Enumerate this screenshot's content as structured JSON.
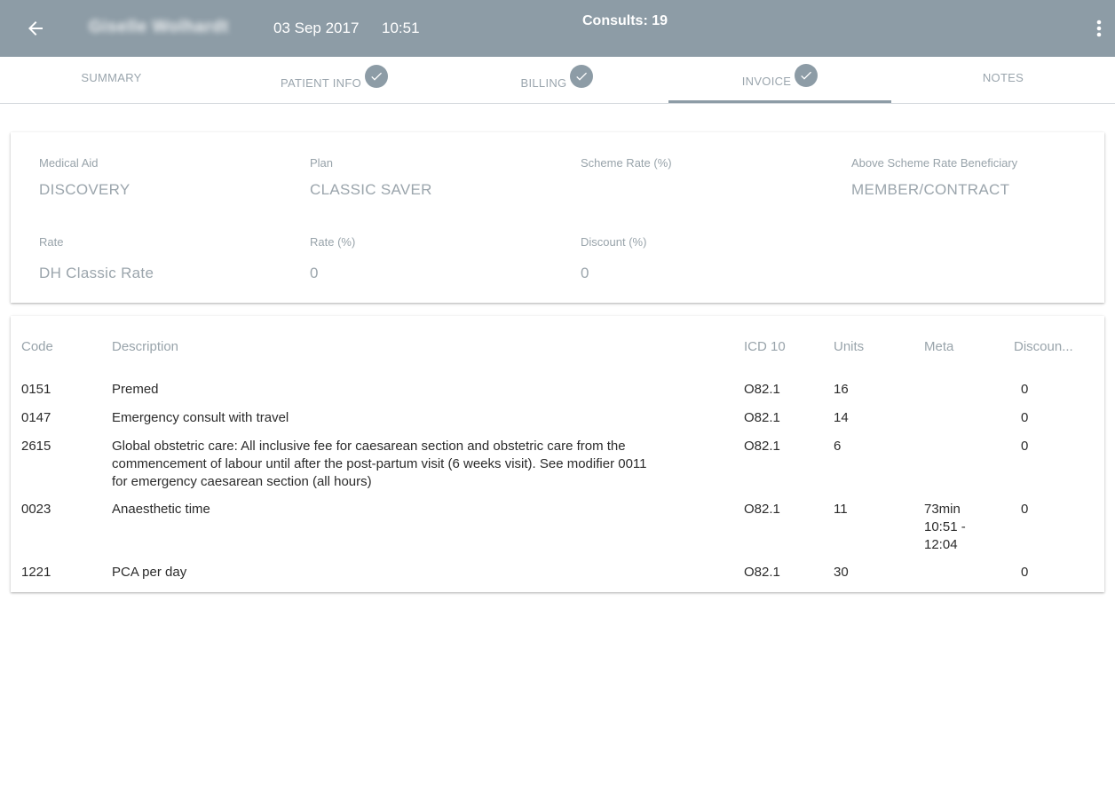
{
  "header": {
    "patient_name": "Giselle Wolhardt",
    "date": "03 Sep 2017",
    "time": "10:51",
    "consults": "Consults: 19"
  },
  "tabs": [
    {
      "label": "SUMMARY",
      "checked": false,
      "active": false
    },
    {
      "label": "PATIENT INFO",
      "checked": true,
      "active": false
    },
    {
      "label": "BILLING",
      "checked": true,
      "active": false
    },
    {
      "label": "INVOICE",
      "checked": true,
      "active": true
    },
    {
      "label": "NOTES",
      "checked": false,
      "active": false
    }
  ],
  "info": {
    "medical_aid_label": "Medical Aid",
    "medical_aid_value": "DISCOVERY",
    "plan_label": "Plan",
    "plan_value": "CLASSIC SAVER",
    "scheme_rate_label": "Scheme Rate (%)",
    "scheme_rate_value": "",
    "beneficiary_label": "Above Scheme Rate Beneficiary",
    "beneficiary_value": "MEMBER/CONTRACT",
    "rate_label": "Rate",
    "rate_value": "DH Classic Rate",
    "rate_pct_label": "Rate (%)",
    "rate_pct_value": "0",
    "discount_label": "Discount (%)",
    "discount_value": "0"
  },
  "table": {
    "headers": {
      "code": "Code",
      "description": "Description",
      "icd": "ICD 10",
      "units": "Units",
      "meta": "Meta",
      "discount": "Discoun..."
    },
    "rows": [
      {
        "code": "0151",
        "description": "Premed",
        "icd": "O82.1",
        "units": "16",
        "meta": "",
        "discount": "0"
      },
      {
        "code": "0147",
        "description": "Emergency consult with travel",
        "icd": "O82.1",
        "units": "14",
        "meta": "",
        "discount": "0"
      },
      {
        "code": "2615",
        "description_lines": [
          "Global obstetric care: All inclusive fee for caesarean section and obstetric care from the",
          "commencement of labour until after the post-partum visit (6 weeks visit). See modifier 0011",
          "for emergency caesarean section (all hours)"
        ],
        "icd": "O82.1",
        "units": "6",
        "meta": "",
        "discount": "0"
      },
      {
        "code": "0023",
        "description": "Anaesthetic time",
        "icd": "O82.1",
        "units": "11",
        "meta_lines": [
          "73min",
          "10:51 -",
          "12:04"
        ],
        "discount": "0"
      },
      {
        "code": "1221",
        "description": "PCA per day",
        "icd": "O82.1",
        "units": "30",
        "meta": "",
        "discount": "0"
      }
    ]
  }
}
